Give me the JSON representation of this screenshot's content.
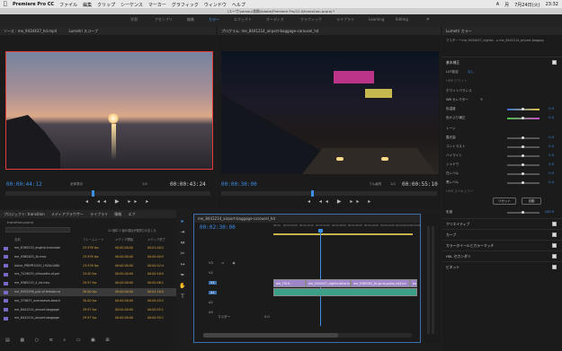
{
  "mac": {
    "apple": "",
    "app": "Premiere Pro CC",
    "menus": [
      "ファイル",
      "編集",
      "クリップ",
      "シーケンス",
      "マーカー",
      "グラフィック",
      "ウィンドウ",
      "ヘルプ"
    ],
    "status": [
      "A",
      "月",
      "7月24日(火)",
      "23:32"
    ]
  },
  "path": "/ユーザ/yamau/書類/Adobe/Premiere Pro/12.0/transition.prproj *",
  "workspaces": [
    "学習",
    "アセンブリ",
    "編集",
    "カラー",
    "エフェクト",
    "オーディオ",
    "グラフィック",
    "ライブラリ",
    "Learning",
    "Editing"
  ],
  "active_workspace": "カラー",
  "source": {
    "tab1": "ソース : me_9434437_hd.mp4",
    "tab2": "Lumetri スコープ",
    "tc_left": "00:00:44:12",
    "fit": "全体表示",
    "page": "1/4",
    "tc_right": "00:00:43:24"
  },
  "program": {
    "tab": "プログラム: me_8441214_airport-baggage-carousel_hd",
    "tc_left": "00:00:30:00",
    "fit": "フル画質",
    "page": "1/2",
    "tc_right": "00:00:55:10"
  },
  "lumetri": {
    "title": "Lumetri カラー",
    "subtitle": "マスター * me_9434437_nightd... ▸ me_8441214_airport-baggag",
    "basic": "基本補正",
    "lut": "LUT設定",
    "lut_val": "なし",
    "hdr": "HDR ホワイト",
    "wb": "ホワイトバランス",
    "wb_sel": "WB セレクター",
    "temp": "色温度",
    "tint": "色かぶり補正",
    "tone": "トーン",
    "exposure": "露光量",
    "contrast": "コントラスト",
    "highlight": "ハイライト",
    "shadow": "シャドウ",
    "white": "白レベル",
    "black": "黒レベル",
    "hdr_spec": "HDR スペキュラー",
    "reset": "リセット",
    "auto": "自動",
    "saturation": "彩度",
    "values": [
      "0.0",
      "0.0",
      "0.0",
      "0.0",
      "0.0",
      "0.0",
      "0.0",
      "0.0",
      "100.0"
    ],
    "sections": [
      "クリエイティブ",
      "カーブ",
      "カラーホイールとカラーマッチ",
      "HSL セカンダリ",
      "ビネット"
    ]
  },
  "project": {
    "tabs": [
      "プロジェクト: transition",
      "メディアブラウザー",
      "ライブラリ",
      "情報",
      "エフ"
    ],
    "file": "transition.prproj",
    "count": "11 個中 1 個の項目が選択されました",
    "cols": [
      "名前",
      "フレームレート",
      "メディア開始",
      "メディア終了"
    ],
    "items": [
      {
        "name": "me_8765570_english-translate",
        "fr": "23.976 fps",
        "s": "00;00;00;00",
        "e": "00;01;40;2"
      },
      {
        "name": "me_9365403_4k.mov",
        "fr": "23.976 fps",
        "s": "00:00:00:00",
        "e": "00:00:40:5"
      },
      {
        "name": "Alone_PREPR5433_1920x1080",
        "fr": "23.976 fps",
        "s": "00:00:00:00",
        "e": "00:00:42:4"
      },
      {
        "name": "me_7419035_silhouette-of-per",
        "fr": "25.00 fps",
        "s": "00:00:00:00",
        "e": "00:00:16:0"
      },
      {
        "name": "me_9365215_4_hd.mov",
        "fr": "29.97 fps",
        "s": "00:00:00:00",
        "e": "00:00:46:1"
      },
      {
        "name": "me_9353296_pull-of-female-ca",
        "fr": "30.00 fps",
        "s": "00:00:00:00",
        "e": "00:01:16:0"
      },
      {
        "name": "me_375637_overseases-beach",
        "fr": "30.00 fps",
        "s": "00:00:00:00",
        "e": "00:00:43:2"
      },
      {
        "name": "me_8441214_airport-baggage",
        "fr": "29.97 fps",
        "s": "00:00:00:00",
        "e": "00:00:55:1"
      },
      {
        "name": "me_8441214_airport-baggage",
        "fr": "29.97 fps",
        "s": "00:00:00:00",
        "e": "00:00:55:1"
      }
    ]
  },
  "timeline": {
    "tab": "me_8441214_airport-baggage-carousel_hd",
    "tc": "00:02:30:00",
    "ruler": [
      "00:00",
      "00:02:04:00",
      "00:02:12:00",
      "00:02:20:00",
      "00:02:28:00",
      "00:02:36:00",
      "00:02:44:00",
      "00:02:52:00",
      "00:03:00:00",
      "00:03:08"
    ],
    "tracks": [
      "V3",
      "V2",
      "V1",
      "A1",
      "A2",
      "A3"
    ],
    "master": "マスター",
    "master_val": "0.0",
    "clips": [
      {
        "t": "V1",
        "label": "me_7919.."
      },
      {
        "t": "V1",
        "label": "me_9434437_nightd-drive-hdmi"
      },
      {
        "t": "V1",
        "label": "me_9365265_4k-go-to-pulse_hd4-hd"
      },
      {
        "t": "V1",
        "label": "me_8441214"
      }
    ]
  },
  "tools": [
    "selection",
    "track-select",
    "ripple",
    "razor",
    "slip",
    "pen",
    "hand",
    "type"
  ]
}
